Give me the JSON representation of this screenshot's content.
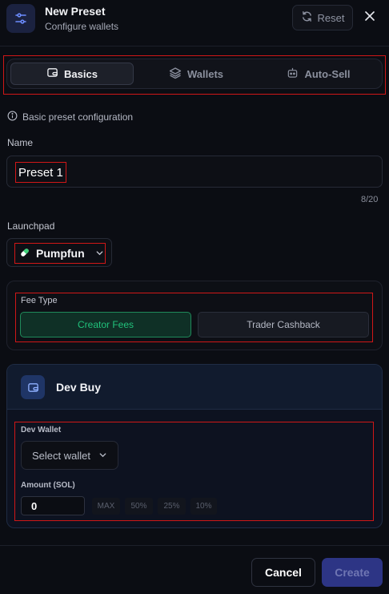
{
  "header": {
    "title": "New Preset",
    "subtitle": "Configure wallets",
    "reset_label": "Reset",
    "app_icon": "sliders-icon",
    "close_icon": "close-icon"
  },
  "tabs": [
    {
      "label": "Basics",
      "icon": "wallet-icon",
      "active": true
    },
    {
      "label": "Wallets",
      "icon": "layers-icon",
      "active": false
    },
    {
      "label": "Auto-Sell",
      "icon": "robot-icon",
      "active": false
    }
  ],
  "info": {
    "text": "Basic preset configuration",
    "icon": "info-icon"
  },
  "name_field": {
    "label": "Name",
    "value": "Preset 1",
    "counter": "8/20"
  },
  "launchpad": {
    "label": "Launchpad",
    "value": "Pumpfun",
    "icon": "pill-icon"
  },
  "fee_type": {
    "label": "Fee Type",
    "options": [
      "Creator Fees",
      "Trader Cashback"
    ],
    "selected": "Creator Fees"
  },
  "dev_buy": {
    "title": "Dev Buy",
    "icon": "wallet-icon",
    "wallet_label": "Dev Wallet",
    "wallet_placeholder": "Select wallet",
    "amount_label": "Amount (SOL)",
    "amount_value": "0",
    "quick_amounts": [
      "MAX",
      "50%",
      "25%",
      "10%"
    ]
  },
  "footer": {
    "cancel_label": "Cancel",
    "create_label": "Create"
  },
  "colors": {
    "background": "#0b0d13",
    "accent_green": "#21c27b",
    "primary_button": "#2d3585",
    "highlight_outline": "#d01717"
  }
}
